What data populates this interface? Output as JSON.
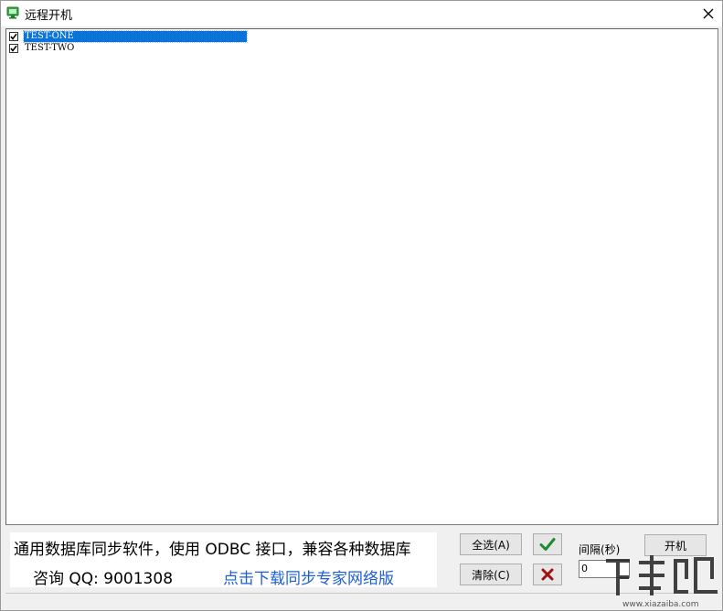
{
  "window": {
    "title": "远程开机"
  },
  "list": {
    "items": [
      {
        "label": "TEST-ONE",
        "checked": true,
        "selected": true
      },
      {
        "label": "TEST-TWO",
        "checked": true,
        "selected": false
      }
    ]
  },
  "ad": {
    "line1": "通用数据库同步软件，使用 ODBC 接口，兼容各种数据库",
    "line2": "咨询 QQ: 9001308",
    "link": "点击下载同步专家网络版"
  },
  "buttons": {
    "select_all": "全选(A)",
    "clear": "清除(C)",
    "power_on": "开机"
  },
  "interval": {
    "label": "间隔(秒)",
    "value": "0"
  },
  "icons": {
    "app": "monitor-icon",
    "close": "close-icon",
    "ok": "checkmark-icon",
    "cancel": "cross-icon"
  },
  "colors": {
    "selection": "#0a74d8",
    "link": "#1f5fd6",
    "ok_green": "#1e8c2e",
    "cancel_red": "#a01010"
  }
}
